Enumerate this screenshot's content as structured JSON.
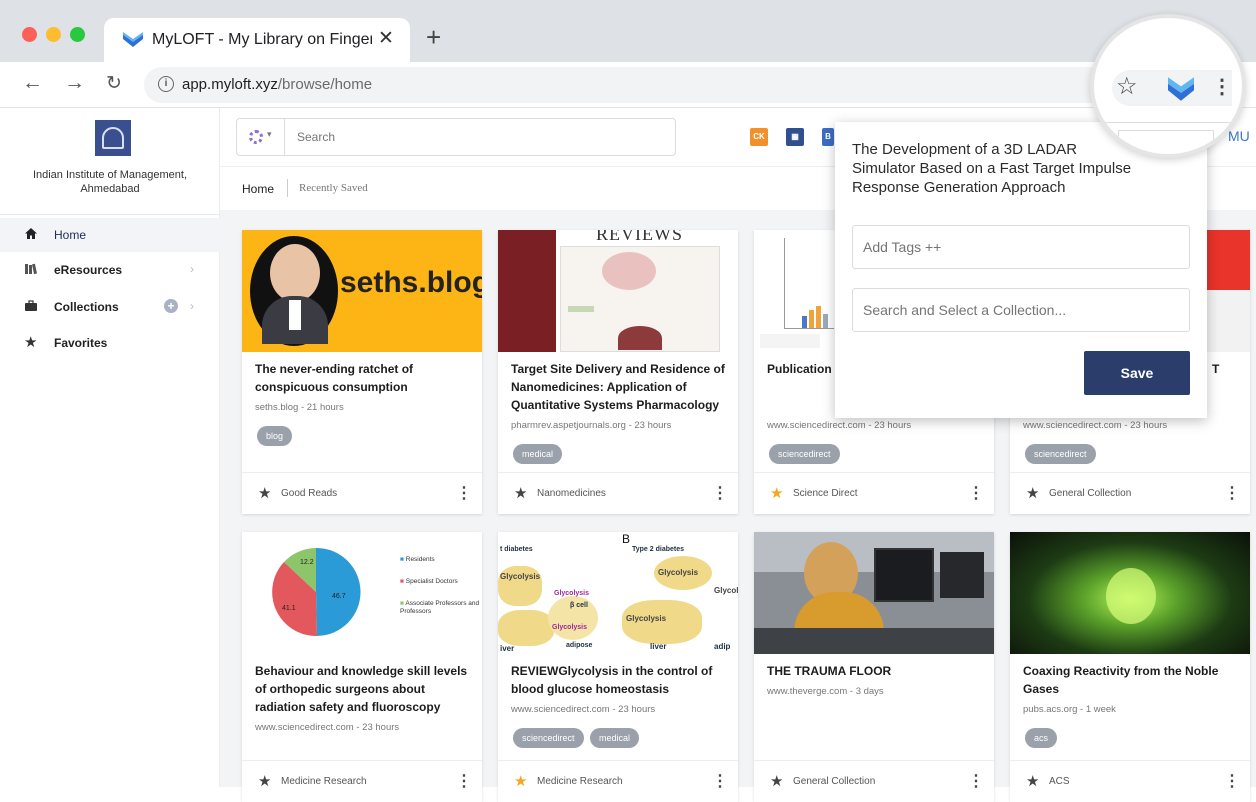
{
  "browser": {
    "tab_title": "MyLOFT - My Library on Finger",
    "url_host": "app.myloft.xyz",
    "url_path": "/browse/home",
    "icons": [
      "back-icon",
      "forward-icon",
      "reload-icon",
      "info-icon",
      "bookmark-star-icon",
      "myloft-extension-icon",
      "menu-icon"
    ]
  },
  "sidebar": {
    "institution": "Indian Institute of Management, Ahmedabad",
    "items": [
      {
        "label": "Home",
        "icon": "home-icon"
      },
      {
        "label": "eResources",
        "icon": "books-icon"
      },
      {
        "label": "Collections",
        "icon": "briefcase-icon"
      },
      {
        "label": "Favorites",
        "icon": "star-icon"
      }
    ]
  },
  "topbar": {
    "search_placeholder": "Search",
    "user_initials": "MU"
  },
  "breadcrumb": {
    "home": "Home",
    "recently_saved": "Recently Saved"
  },
  "cards": [
    {
      "title": "The never-ending ratchet of conspicuous consumption",
      "meta": "seths.blog - 21 hours",
      "tags": [
        "blog"
      ],
      "collection": "Good Reads",
      "favorite": false
    },
    {
      "title": "Target Site Delivery and Residence of Nanomedicines: Application of Quantitative Systems Pharmacology",
      "meta": "pharmrev.aspetjournals.org - 23 hours",
      "tags": [
        "medical"
      ],
      "collection": "Nanomedicines",
      "favorite": false
    },
    {
      "title": "Publication presented a 24th (2014)",
      "meta": "www.sciencedirect.com - 23 hours",
      "tags": [
        "sciencedirect"
      ],
      "collection": "Science Direct",
      "favorite": true
    },
    {
      "title": "T",
      "meta": "www.sciencedirect.com - 23 hours",
      "tags": [
        "sciencedirect"
      ],
      "collection": "General Collection",
      "favorite": false
    },
    {
      "title": "Behaviour and knowledge skill levels of orthopedic surgeons about radiation safety and fluoroscopy",
      "meta": "www.sciencedirect.com - 23 hours",
      "tags": [],
      "collection": "Medicine Research",
      "favorite": false
    },
    {
      "title": "REVIEWGlycolysis in the control of blood glucose homeostasis",
      "meta": "www.sciencedirect.com - 23 hours",
      "tags": [
        "sciencedirect",
        "medical"
      ],
      "collection": "Medicine Research",
      "favorite": true
    },
    {
      "title": "THE TRAUMA FLOOR",
      "meta": "www.theverge.com - 3 days",
      "tags": [],
      "collection": "General Collection",
      "favorite": false
    },
    {
      "title": "Coaxing Reactivity from the Noble Gases",
      "meta": "pubs.acs.org - 1 week",
      "tags": [
        "acs"
      ],
      "collection": "ACS",
      "favorite": false
    }
  ],
  "card_images": {
    "seths_blog_text": "seths.blog",
    "reviews_text": "REVIEWS",
    "pie_legend": [
      "Residents",
      "Specialist Doctors",
      "Associate Professors and Professors"
    ],
    "pie_values": [
      "46.7",
      "41.1",
      "12.2"
    ],
    "glycolysis_labels": [
      "t diabetes",
      "Type 2 diabetes",
      "Glycolysis",
      "Glycolysis",
      "Glycolysis",
      "β cell",
      "Glycolysis",
      "Glycolysis",
      "Glycolysis",
      "adipose",
      "liver",
      "iver",
      "adip",
      "B"
    ]
  },
  "popup": {
    "title": "The Development of a 3D LADAR Simulator Based on a Fast Target Impulse Response Generation Approach",
    "tags_placeholder": "Add Tags ++",
    "collection_placeholder": "Search and Select a Collection...",
    "save_label": "Save"
  },
  "colors": {
    "save_button": "#2b3d6b",
    "accent_blue": "#3b78c9",
    "favorite_star": "#f5a623",
    "seths_bg": "#fdb515"
  }
}
